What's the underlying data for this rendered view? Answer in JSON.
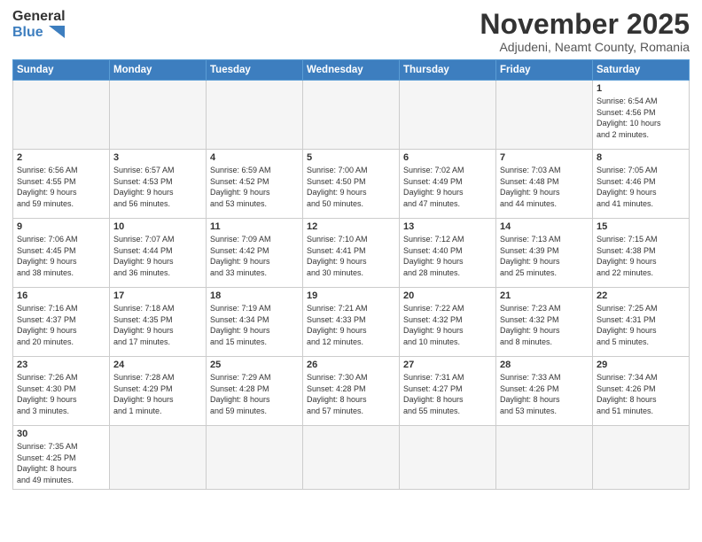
{
  "header": {
    "logo_general": "General",
    "logo_blue": "Blue",
    "month_title": "November 2025",
    "subtitle": "Adjudeni, Neamt County, Romania"
  },
  "weekdays": [
    "Sunday",
    "Monday",
    "Tuesday",
    "Wednesday",
    "Thursday",
    "Friday",
    "Saturday"
  ],
  "days": {
    "1": {
      "sunrise": "6:54 AM",
      "sunset": "4:56 PM",
      "daylight": "10 hours and 2 minutes."
    },
    "2": {
      "sunrise": "6:56 AM",
      "sunset": "4:55 PM",
      "daylight": "9 hours and 59 minutes."
    },
    "3": {
      "sunrise": "6:57 AM",
      "sunset": "4:53 PM",
      "daylight": "9 hours and 56 minutes."
    },
    "4": {
      "sunrise": "6:59 AM",
      "sunset": "4:52 PM",
      "daylight": "9 hours and 53 minutes."
    },
    "5": {
      "sunrise": "7:00 AM",
      "sunset": "4:50 PM",
      "daylight": "9 hours and 50 minutes."
    },
    "6": {
      "sunrise": "7:02 AM",
      "sunset": "4:49 PM",
      "daylight": "9 hours and 47 minutes."
    },
    "7": {
      "sunrise": "7:03 AM",
      "sunset": "4:48 PM",
      "daylight": "9 hours and 44 minutes."
    },
    "8": {
      "sunrise": "7:05 AM",
      "sunset": "4:46 PM",
      "daylight": "9 hours and 41 minutes."
    },
    "9": {
      "sunrise": "7:06 AM",
      "sunset": "4:45 PM",
      "daylight": "9 hours and 38 minutes."
    },
    "10": {
      "sunrise": "7:07 AM",
      "sunset": "4:44 PM",
      "daylight": "9 hours and 36 minutes."
    },
    "11": {
      "sunrise": "7:09 AM",
      "sunset": "4:42 PM",
      "daylight": "9 hours and 33 minutes."
    },
    "12": {
      "sunrise": "7:10 AM",
      "sunset": "4:41 PM",
      "daylight": "9 hours and 30 minutes."
    },
    "13": {
      "sunrise": "7:12 AM",
      "sunset": "4:40 PM",
      "daylight": "9 hours and 28 minutes."
    },
    "14": {
      "sunrise": "7:13 AM",
      "sunset": "4:39 PM",
      "daylight": "9 hours and 25 minutes."
    },
    "15": {
      "sunrise": "7:15 AM",
      "sunset": "4:38 PM",
      "daylight": "9 hours and 22 minutes."
    },
    "16": {
      "sunrise": "7:16 AM",
      "sunset": "4:37 PM",
      "daylight": "9 hours and 20 minutes."
    },
    "17": {
      "sunrise": "7:18 AM",
      "sunset": "4:35 PM",
      "daylight": "9 hours and 17 minutes."
    },
    "18": {
      "sunrise": "7:19 AM",
      "sunset": "4:34 PM",
      "daylight": "9 hours and 15 minutes."
    },
    "19": {
      "sunrise": "7:21 AM",
      "sunset": "4:33 PM",
      "daylight": "9 hours and 12 minutes."
    },
    "20": {
      "sunrise": "7:22 AM",
      "sunset": "4:32 PM",
      "daylight": "9 hours and 10 minutes."
    },
    "21": {
      "sunrise": "7:23 AM",
      "sunset": "4:32 PM",
      "daylight": "9 hours and 8 minutes."
    },
    "22": {
      "sunrise": "7:25 AM",
      "sunset": "4:31 PM",
      "daylight": "9 hours and 5 minutes."
    },
    "23": {
      "sunrise": "7:26 AM",
      "sunset": "4:30 PM",
      "daylight": "9 hours and 3 minutes."
    },
    "24": {
      "sunrise": "7:28 AM",
      "sunset": "4:29 PM",
      "daylight": "9 hours and 1 minute."
    },
    "25": {
      "sunrise": "7:29 AM",
      "sunset": "4:28 PM",
      "daylight": "8 hours and 59 minutes."
    },
    "26": {
      "sunrise": "7:30 AM",
      "sunset": "4:28 PM",
      "daylight": "8 hours and 57 minutes."
    },
    "27": {
      "sunrise": "7:31 AM",
      "sunset": "4:27 PM",
      "daylight": "8 hours and 55 minutes."
    },
    "28": {
      "sunrise": "7:33 AM",
      "sunset": "4:26 PM",
      "daylight": "8 hours and 53 minutes."
    },
    "29": {
      "sunrise": "7:34 AM",
      "sunset": "4:26 PM",
      "daylight": "8 hours and 51 minutes."
    },
    "30": {
      "sunrise": "7:35 AM",
      "sunset": "4:25 PM",
      "daylight": "8 hours and 49 minutes."
    }
  }
}
